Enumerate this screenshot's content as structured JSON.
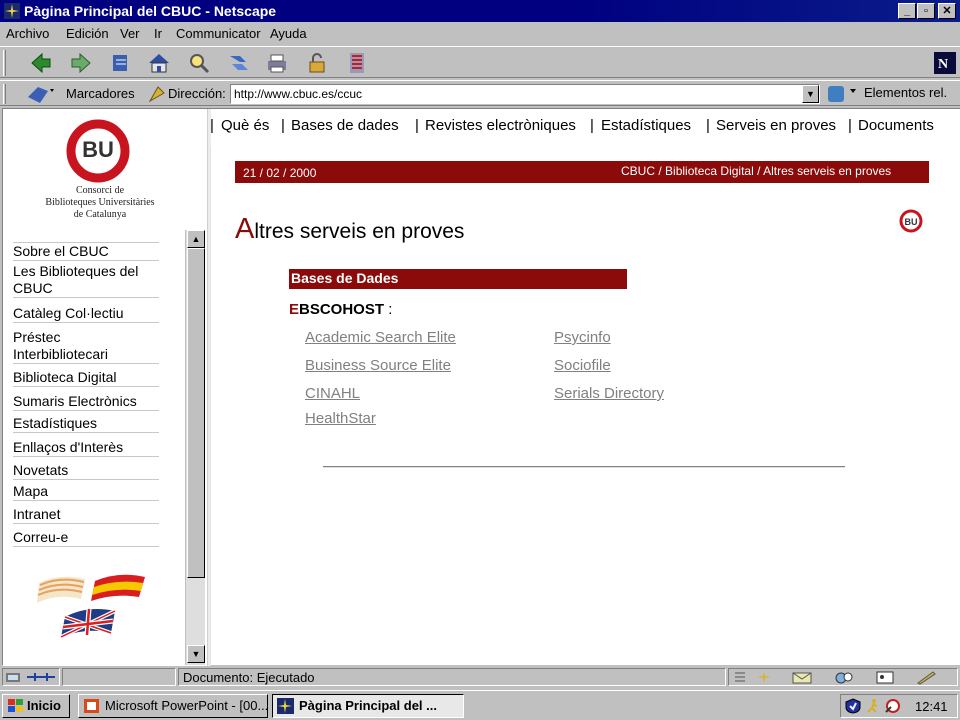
{
  "window": {
    "title": "Pàgina Principal del CBUC - Netscape"
  },
  "menu": [
    "Archivo",
    "Edición",
    "Ver",
    "Ir",
    "Communicator",
    "Ayuda"
  ],
  "location": {
    "bookmarks_label": "Marcadores",
    "address_label": "Dirección:",
    "url": "http://www.cbuc.es/ccuc",
    "related_label": "Elementos rel."
  },
  "logo": {
    "mark": "BU",
    "org_lines": [
      "Consorci de",
      "Biblioteques Universitàries",
      "de Catalunya"
    ]
  },
  "sidebar": {
    "items": [
      "Sobre el CBUC",
      "Les Biblioteques del CBUC",
      "Catàleg Col·lectiu",
      "Préstec Interbibliotecari",
      "Biblioteca Digital",
      "Sumaris Electrònics",
      "Estadístiques",
      "Enllaços d'Interès",
      "Novetats",
      "Mapa",
      "Intranet",
      "Correu-e"
    ]
  },
  "topnav": [
    "Què és",
    "Bases de dades",
    "Revistes electròniques",
    "Estadístiques",
    "Serveis en proves",
    "Documents"
  ],
  "date": "21 / 02 / 2000",
  "breadcrumb": [
    "CBUC",
    "Biblioteca Digital",
    "Altres serveis en proves"
  ],
  "page_title": {
    "initial": "A",
    "rest": "ltres serveis en proves"
  },
  "section": "Bases de Dades",
  "provider": {
    "initial": "E",
    "rest": "BSCOHOST",
    "suffix": " :"
  },
  "databases_left": [
    "Academic Search Elite",
    "Business Source Elite",
    "CINAHL",
    "HealthStar"
  ],
  "databases_right": [
    "Psycinfo",
    "Sociofile",
    "Serials Directory"
  ],
  "status": {
    "text": "Documento: Ejecutado"
  },
  "taskbar": {
    "start": "Inicio",
    "tasks": [
      "Microsoft PowerPoint - [00...",
      "Pàgina Principal del ..."
    ],
    "clock": "12:41"
  },
  "colors": {
    "accent": "#8b0a0a",
    "titlebar": "#000080",
    "link": "#808080"
  }
}
